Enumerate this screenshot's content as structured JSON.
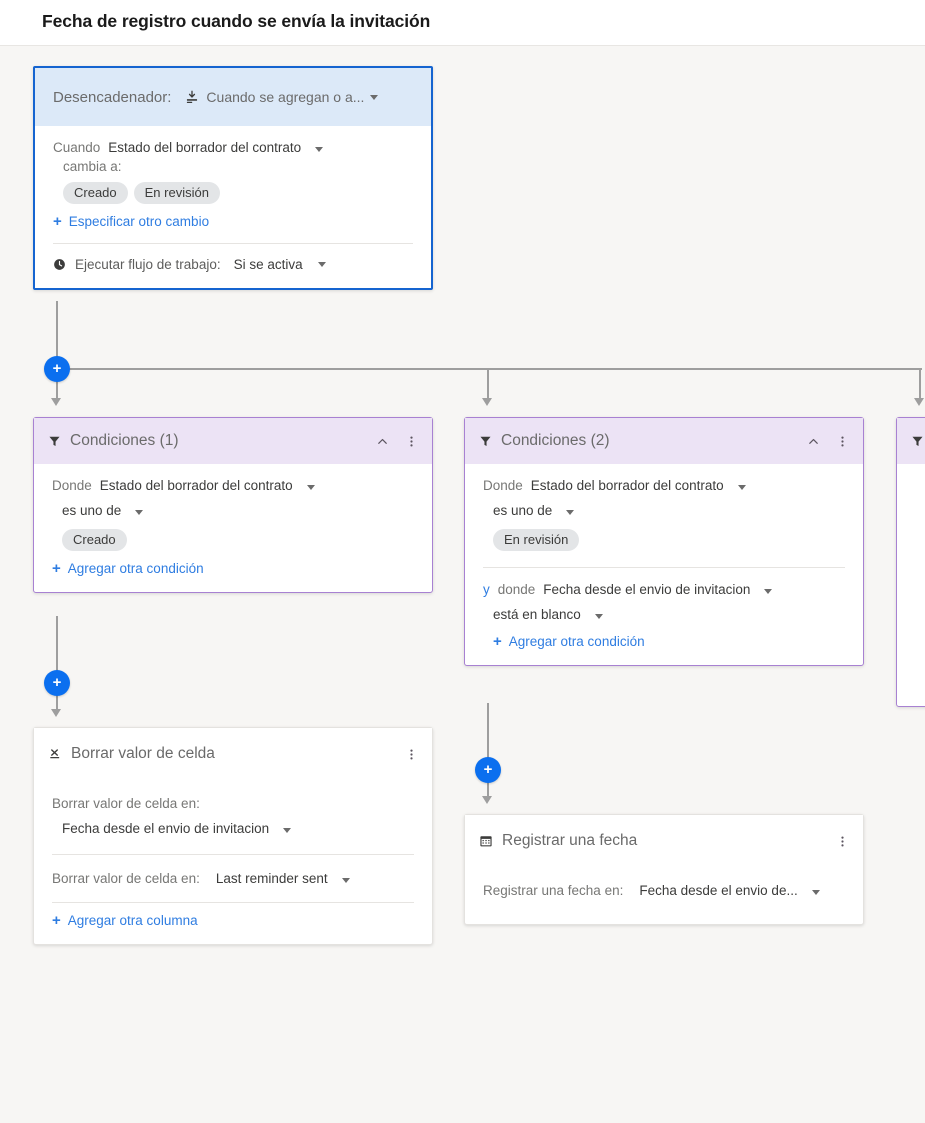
{
  "header": {
    "title": "Fecha de registro cuando se envía la invitación"
  },
  "trigger": {
    "label": "Desencadenador:",
    "icon": "add-row-icon",
    "value": "Cuando se agregan o a...",
    "when_label": "Cuando",
    "when_field": "Estado del borrador del contrato",
    "changes_to_label": "cambia a:",
    "chips": [
      "Creado",
      "En revisión"
    ],
    "add_change_link": "Especificar otro cambio",
    "run_icon": "clock-icon",
    "run_label": "Ejecutar flujo de trabajo:",
    "run_value": "Si se activa"
  },
  "conditions_1": {
    "icon": "filter-icon",
    "title": "Condiciones (1)",
    "collapse_icon": "chevron-up-icon",
    "menu_icon": "more-vertical-icon",
    "where_label": "Donde",
    "where_field": "Estado del borrador del contrato",
    "operator": "es uno de",
    "chips": [
      "Creado"
    ],
    "add_condition_link": "Agregar otra condición"
  },
  "conditions_2": {
    "icon": "filter-icon",
    "title": "Condiciones (2)",
    "collapse_icon": "chevron-up-icon",
    "menu_icon": "more-vertical-icon",
    "where_label": "Donde",
    "where_field": "Estado del borrador del contrato",
    "operator": "es uno de",
    "chips": [
      "En revisión"
    ],
    "conjunction": "y",
    "and_where_label": "donde",
    "and_where_field": "Fecha desde el envio de invitacion",
    "and_operator": "está en blanco",
    "add_condition_link": "Agregar otra condición"
  },
  "conditions_3": {
    "icon": "filter-icon"
  },
  "clear_cell": {
    "icon": "clear-cell-icon",
    "title": "Borrar valor de celda",
    "menu_icon": "more-vertical-icon",
    "field1_label": "Borrar valor de celda en:",
    "field1_value": "Fecha desde el envio de invitacion",
    "field2_label": "Borrar valor de celda en:",
    "field2_value": "Last reminder sent",
    "add_column_link": "Agregar otra columna"
  },
  "record_date": {
    "icon": "calendar-icon",
    "title": "Registrar una fecha",
    "menu_icon": "more-vertical-icon",
    "field_label": "Registrar una fecha en:",
    "field_value": "Fecha desde el envio de..."
  },
  "add_buttons": {
    "glyph": "+",
    "name_branch": "add-step-after-trigger",
    "name_below_cond1": "add-step-after-conditions-1",
    "name_below_cond2": "add-step-after-conditions-2"
  },
  "colors": {
    "accent_blue": "#0b6fef",
    "trigger_border": "#1564d0",
    "trigger_header": "#dce9f8",
    "condition_border": "#a881d2",
    "condition_header": "#ece3f5",
    "canvas_bg": "#f7f6f4",
    "link_blue": "#2f7de1",
    "connector_gray": "#9e9e9e"
  }
}
